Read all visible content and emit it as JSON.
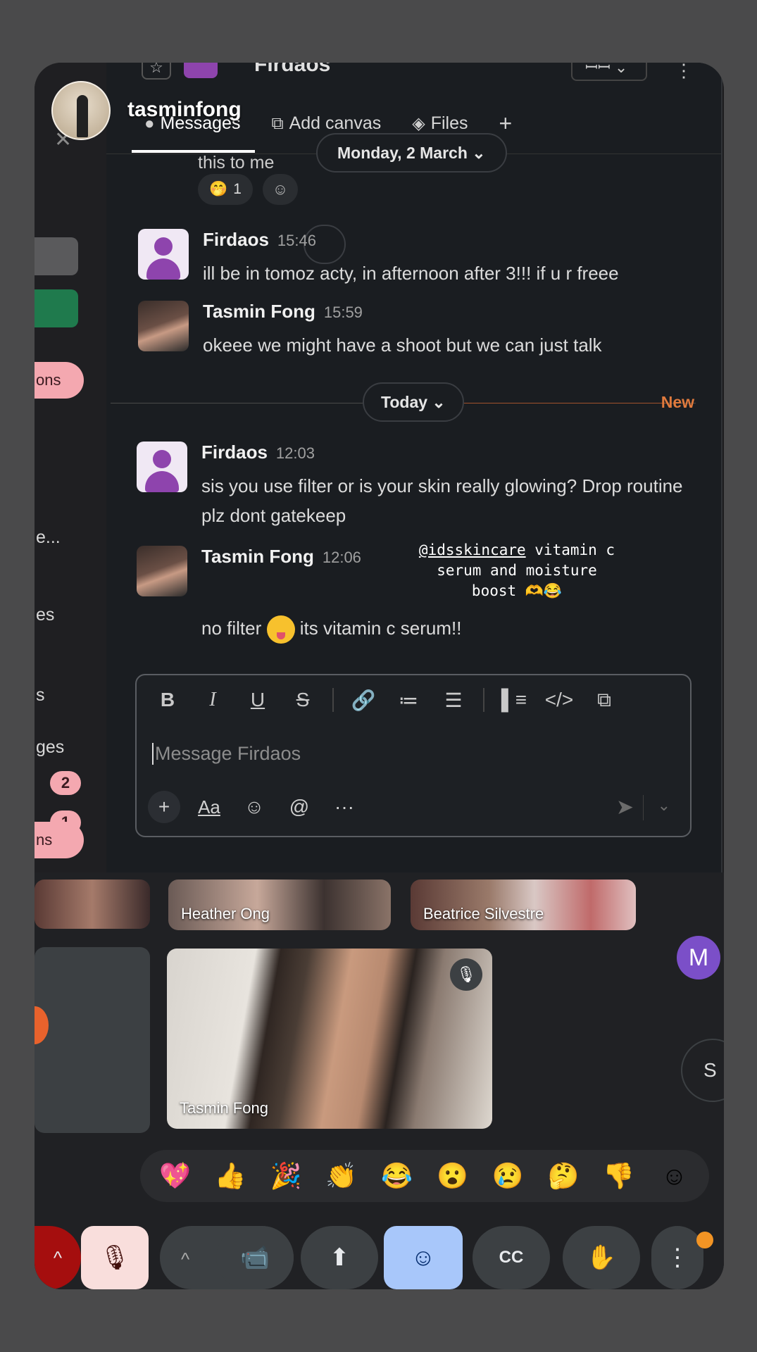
{
  "story": {
    "username": "tasminfong"
  },
  "sidebar": {
    "pills": [
      "ons",
      "ns"
    ],
    "labels": [
      "e...",
      "es",
      "s",
      "ges"
    ],
    "badges": [
      "2",
      "1"
    ]
  },
  "header": {
    "channel_name": "Firdaos",
    "tabs": [
      {
        "label": "Messages",
        "icon": "chat-bubble-icon"
      },
      {
        "label": "Add canvas",
        "icon": "canvas-icon"
      },
      {
        "label": "Files",
        "icon": "layers-icon"
      }
    ]
  },
  "messages": {
    "prev_tail": "this to me",
    "reaction": {
      "emoji": "🤭",
      "count": "1"
    },
    "date_dividers": {
      "monday": "Monday, 2 March ⌄",
      "today": "Today ⌄",
      "new_label": "New"
    },
    "items": [
      {
        "author": "Firdaos",
        "time": "15:46",
        "text": "ill be in tomoz acty, in afternoon after 3!!! if u r freee"
      },
      {
        "author": "Tasmin Fong",
        "time": "15:59",
        "text": "okeee we might have a shoot but we can just talk"
      },
      {
        "author": "Firdaos",
        "time": "12:03",
        "text": "sis you use filter or is your skin really glowing? Drop routine plz dont gatekeep"
      },
      {
        "author": "Tasmin Fong",
        "time": "12:06",
        "text_before": "no filter",
        "text_after": "its vitamin c serum!!"
      }
    ],
    "story_overlay": {
      "mention": "@idsskincare",
      "line1_rest": " vitamin c",
      "line2": "serum and moisture",
      "line3": "boost 🫶😂"
    }
  },
  "composer": {
    "placeholder": "Message Firdaos",
    "format_buttons": [
      "B",
      "I",
      "U",
      "S",
      "🔗",
      "≔",
      "☰",
      "▌≡",
      "</>",
      "⧉"
    ],
    "action_buttons": [
      "+",
      "Aa",
      "☺",
      "@",
      "···"
    ]
  },
  "meet": {
    "tiles": [
      {
        "name": "Heather Ong"
      },
      {
        "name": "Beatrice Silvestre"
      },
      {
        "name": "Tasmin Fong"
      }
    ],
    "participant_initial": "M",
    "side_button_text": "S",
    "reactions": [
      "💖",
      "👍",
      "🎉",
      "👏",
      "😂",
      "😮",
      "😢",
      "🤔",
      "👎",
      "☺"
    ],
    "controls": {
      "more_up": "^",
      "mic": "🎙",
      "camera_up": "^",
      "camera": "📹",
      "present": "⬆",
      "emoji": "☺",
      "captions": "CC",
      "raise_hand": "✋",
      "more": "⋮"
    }
  }
}
